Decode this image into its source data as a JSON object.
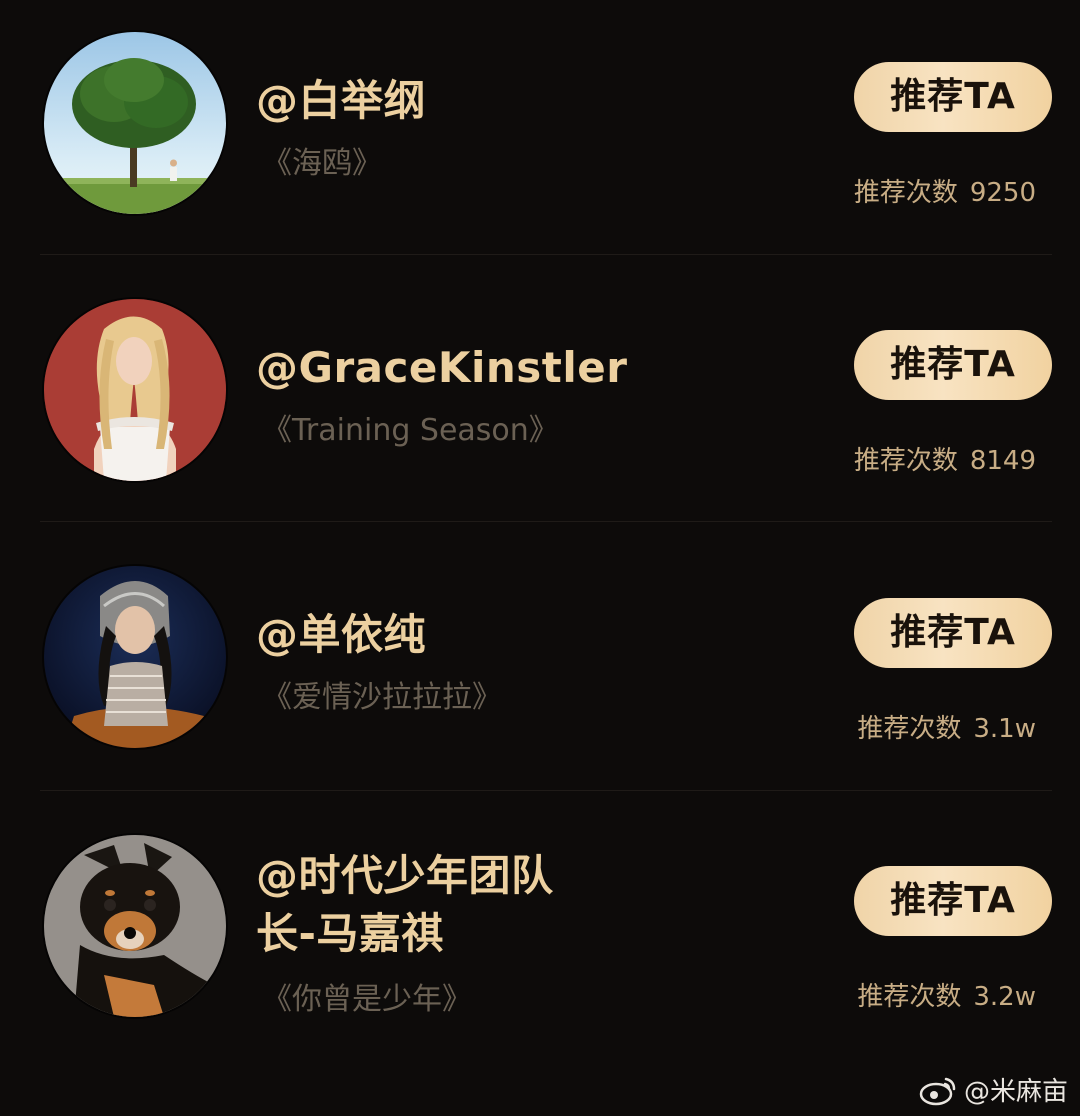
{
  "rows": [
    {
      "name": "@白举纲",
      "name_line2": "",
      "song": "《海鸥》",
      "button": "推荐TA",
      "count_label": "推荐次数",
      "count_value": "9250",
      "avatar": "tree-avatar"
    },
    {
      "name": "@GraceKinstler",
      "name_line2": "",
      "song": "《Training Season》",
      "button": "推荐TA",
      "count_label": "推荐次数",
      "count_value": "8149",
      "avatar": "blonde-woman-avatar"
    },
    {
      "name": "@单依纯",
      "name_line2": "",
      "song": "《爱情沙拉拉拉》",
      "button": "推荐TA",
      "count_label": "推荐次数",
      "count_value": "3.1w",
      "avatar": "woman-headpiece-avatar"
    },
    {
      "name": "@时代少年团队",
      "name_line2": "长-马嘉祺",
      "song": "《你曾是少年》",
      "button": "推荐TA",
      "count_label": "推荐次数",
      "count_value": "3.2w",
      "avatar": "shiba-dog-avatar"
    }
  ],
  "watermark": {
    "text": "@米麻亩",
    "icon": "weibo-icon"
  },
  "colors": {
    "background": "#0d0b0a",
    "name": "#ecd0a0",
    "song": "#6b6154",
    "count": "#c8ad85",
    "button_bg": "#f4dcb4",
    "button_text": "#1a120b"
  }
}
